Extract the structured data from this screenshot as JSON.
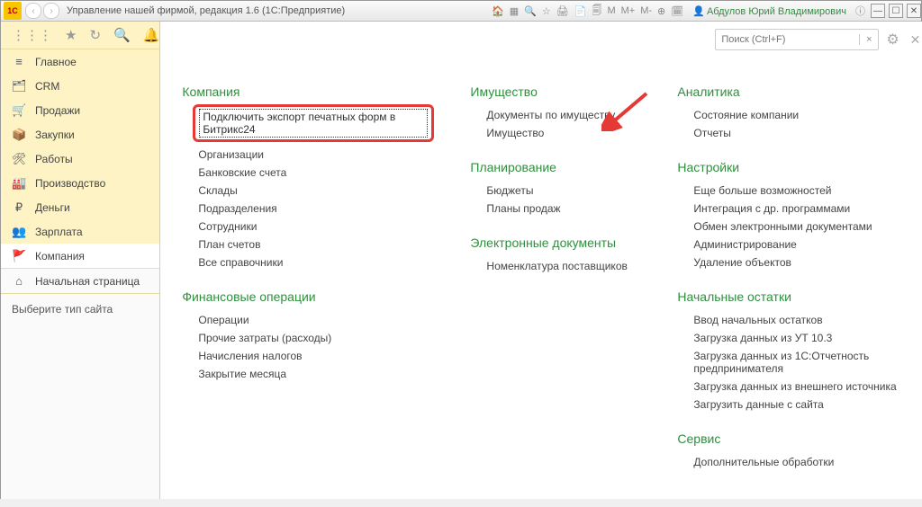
{
  "titlebar": {
    "logo": "1C",
    "title": "Управление нашей фирмой, редакция 1.6  (1С:Предприятие)",
    "m": "M",
    "mplus": "M+",
    "mminus": "M-",
    "user": "Абдулов Юрий Владимирович"
  },
  "search": {
    "placeholder": "Поиск (Ctrl+F)",
    "clear": "×"
  },
  "sidebar": {
    "items": [
      {
        "icon": "≡",
        "label": "Главное"
      },
      {
        "icon": "🗂",
        "label": "CRM"
      },
      {
        "icon": "🛒",
        "label": "Продажи"
      },
      {
        "icon": "📦",
        "label": "Закупки"
      },
      {
        "icon": "🛠",
        "label": "Работы"
      },
      {
        "icon": "🏭",
        "label": "Производство"
      },
      {
        "icon": "₽",
        "label": "Деньги"
      },
      {
        "icon": "👥",
        "label": "Зарплата"
      },
      {
        "icon": "🚩",
        "label": "Компания"
      }
    ],
    "home": {
      "icon": "⌂",
      "label": "Начальная страница"
    },
    "select_site": "Выберите тип сайта"
  },
  "main": {
    "col1": [
      {
        "title": "Компания",
        "links": [
          "Подключить экспорт печатных форм в Битрикс24",
          "Организации",
          "Банковские счета",
          "Склады",
          "Подразделения",
          "Сотрудники",
          "План счетов",
          "Все справочники"
        ]
      },
      {
        "title": "Финансовые операции",
        "links": [
          "Операции",
          "Прочие затраты (расходы)",
          "Начисления налогов",
          "Закрытие месяца"
        ]
      }
    ],
    "col2": [
      {
        "title": "Имущество",
        "links": [
          "Документы по имуществу",
          "Имущество"
        ]
      },
      {
        "title": "Планирование",
        "links": [
          "Бюджеты",
          "Планы продаж"
        ]
      },
      {
        "title": "Электронные документы",
        "links": [
          "Номенклатура поставщиков"
        ]
      }
    ],
    "col3": [
      {
        "title": "Аналитика",
        "links": [
          "Состояние компании",
          "Отчеты"
        ]
      },
      {
        "title": "Настройки",
        "links": [
          "Еще больше возможностей",
          "Интеграция с др. программами",
          "Обмен электронными документами",
          "Администрирование",
          "Удаление объектов"
        ]
      },
      {
        "title": "Начальные остатки",
        "links": [
          "Ввод начальных остатков",
          "Загрузка данных из УТ 10.3",
          "Загрузка данных из 1С:Отчетность предпринимателя",
          "Загрузка данных из внешнего источника",
          "Загрузить данные с сайта"
        ]
      },
      {
        "title": "Сервис",
        "links": [
          "Дополнительные обработки"
        ]
      }
    ]
  }
}
